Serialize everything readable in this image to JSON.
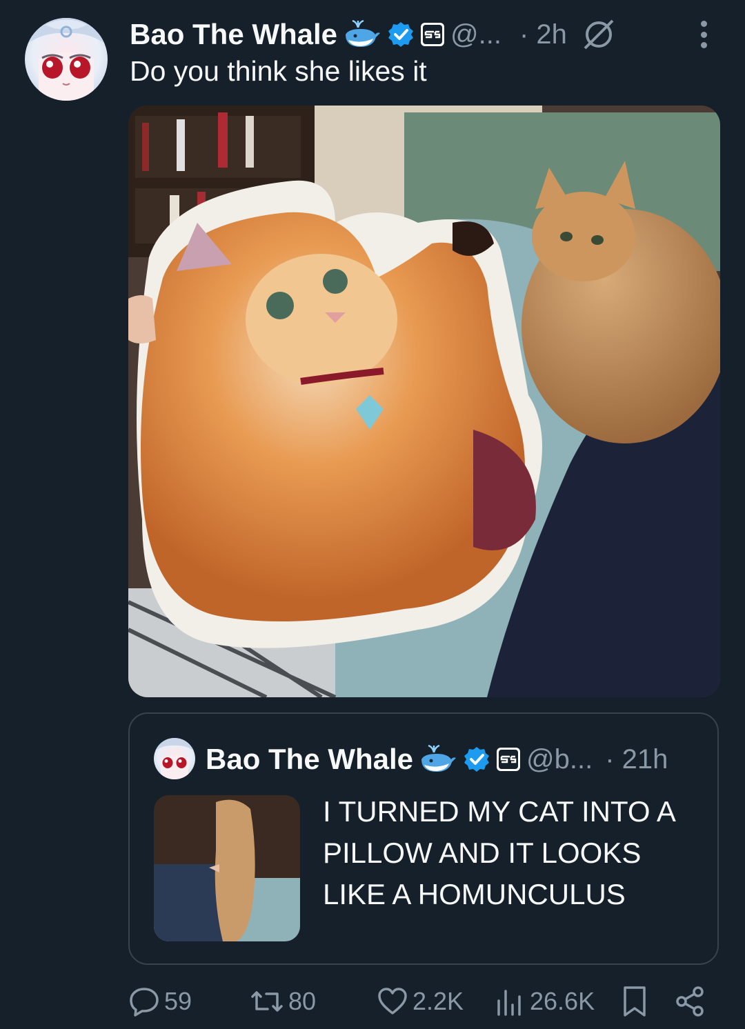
{
  "tweet": {
    "author": {
      "display_name": "Bao The Whale",
      "handle": "@...",
      "time": "· 2h",
      "avatar_icon": "anime-avatar"
    },
    "text": "Do you think she likes it",
    "media_description_icon": "cat-pillow-photo"
  },
  "quote": {
    "author": {
      "display_name": "Bao The Whale",
      "handle": "@b...",
      "time": "· 21h"
    },
    "text": "I TURNED MY CAT INTO A PILLOW AND IT LOOKS LIKE A HOMUNCULUS"
  },
  "actions": {
    "replies": "59",
    "reposts": "80",
    "likes": "2.2K",
    "views": "26.6K"
  },
  "colors": {
    "background": "#15202b",
    "text": "#f7f9f9",
    "secondary": "#8b98a5",
    "verified": "#1d9bf0",
    "border": "#38444d"
  }
}
